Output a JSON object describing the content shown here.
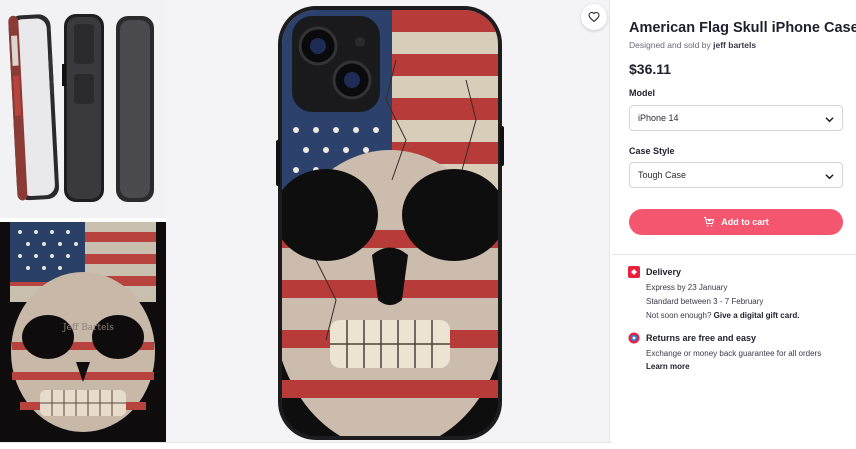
{
  "product": {
    "title": "American Flag Skull iPhone Case",
    "byline_prefix": "Designed and sold by",
    "artist": "jeff bartels",
    "price": "$36.11"
  },
  "options": {
    "model_label": "Model",
    "model_value": "iPhone 14",
    "style_label": "Case Style",
    "style_value": "Tough Case"
  },
  "cart": {
    "label": "Add to cart"
  },
  "delivery": {
    "heading": "Delivery",
    "express": "Express by 23 January",
    "standard": "Standard between 3 - 7 February",
    "soon_prefix": "Not soon enough?",
    "gift_link": "Give a digital gift card."
  },
  "returns": {
    "heading": "Returns are free and easy",
    "detail": "Exchange or money back guarantee for all orders",
    "learn_more": "Learn more"
  },
  "thumbnail_watermark": "Jeff Bartels",
  "icons": {
    "favorite": "heart-icon",
    "dropdown": "chevron-down-icon",
    "cart": "cart-icon",
    "delivery": "delivery-icon",
    "returns": "returns-icon"
  },
  "colors": {
    "accent": "#f4566f",
    "delivery_icon": "#e8213d",
    "text": "#1f1f2e"
  }
}
